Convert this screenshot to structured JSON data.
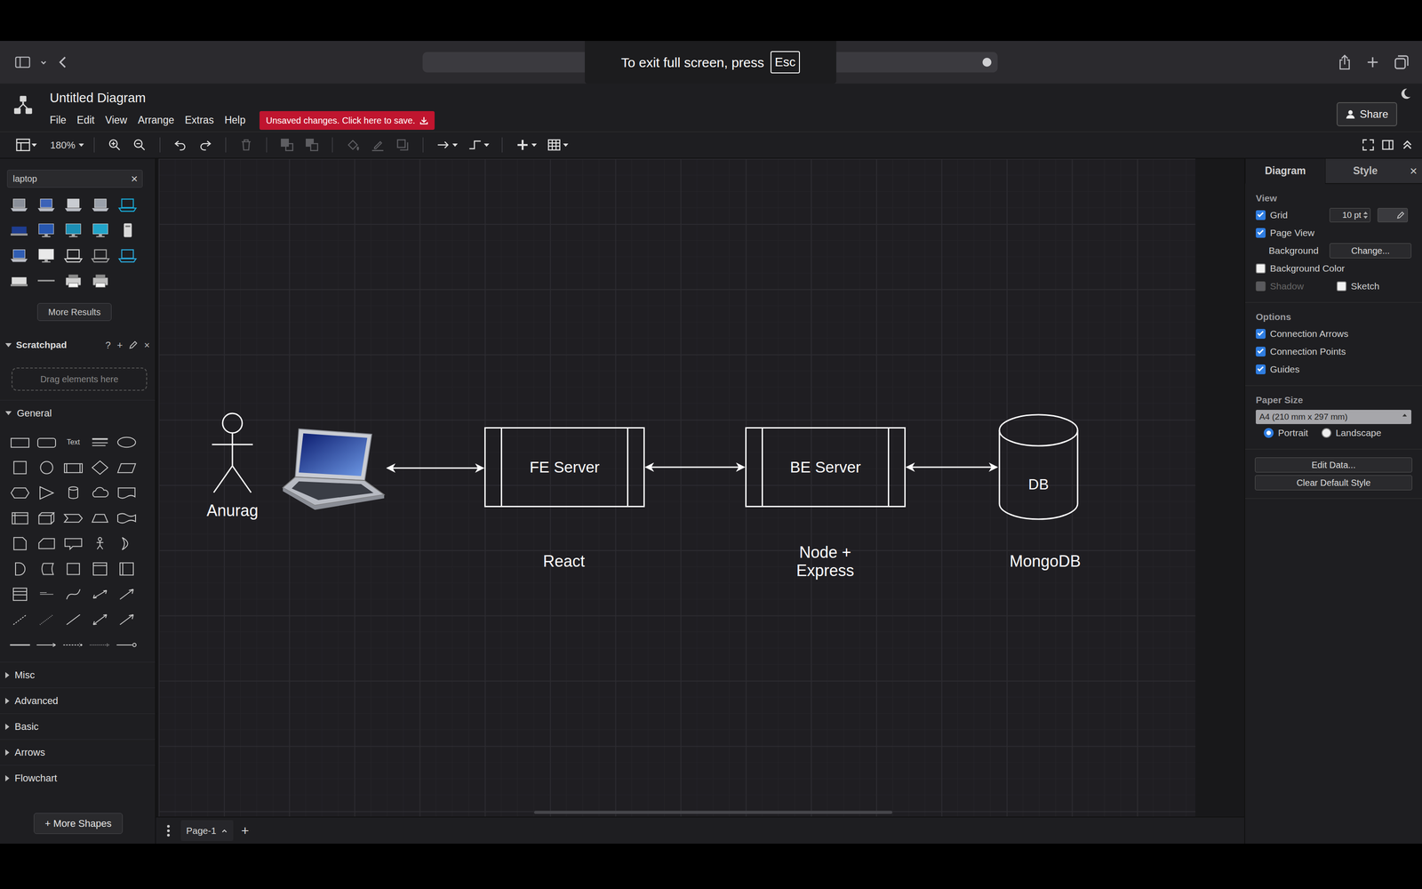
{
  "browser": {
    "hint": "To exit full screen, press",
    "key": "Esc"
  },
  "app": {
    "title": "Untitled Diagram",
    "menus": [
      "File",
      "Edit",
      "View",
      "Arrange",
      "Extras",
      "Help"
    ],
    "unsaved": "Unsaved changes. Click here to save.",
    "share": "Share"
  },
  "toolbar": {
    "zoom": "180%",
    "groups": [
      [
        {
          "kind": "zoom-in",
          "disabled": false
        },
        {
          "kind": "zoom-out",
          "disabled": false
        }
      ],
      [
        {
          "kind": "undo",
          "disabled": false
        },
        {
          "kind": "redo",
          "disabled": false
        }
      ],
      [
        {
          "kind": "delete",
          "disabled": true
        }
      ],
      [
        {
          "kind": "to-front",
          "disabled": true
        },
        {
          "kind": "to-back",
          "disabled": true
        }
      ],
      [
        {
          "kind": "fill",
          "disabled": true
        },
        {
          "kind": "line-color",
          "disabled": true
        },
        {
          "kind": "shadow",
          "disabled": true
        }
      ],
      [
        {
          "kind": "connection",
          "disabled": false
        },
        {
          "kind": "waypoints",
          "disabled": false
        }
      ],
      [
        {
          "kind": "insert",
          "disabled": false
        },
        {
          "kind": "table",
          "disabled": false
        }
      ]
    ]
  },
  "sidebar": {
    "search": {
      "value": "laptop",
      "clear": "×"
    },
    "more_results": "More Results",
    "scratchpad": {
      "title": "Scratchpad",
      "expanded": true,
      "help": "?",
      "add": "+",
      "close": "×",
      "hint": "Drag elements here"
    },
    "sections": [
      {
        "label": "General",
        "expanded": true
      },
      {
        "label": "Misc",
        "expanded": false
      },
      {
        "label": "Advanced",
        "expanded": false
      },
      {
        "label": "Basic",
        "expanded": false
      },
      {
        "label": "Arrows",
        "expanded": false
      },
      {
        "label": "Flowchart",
        "expanded": false
      }
    ],
    "shape_text": "Text",
    "more_shapes": "+ More Shapes"
  },
  "diagram": {
    "nodes": [
      {
        "kind": "actor",
        "label": "Anurag"
      },
      {
        "kind": "laptop"
      },
      {
        "kind": "process",
        "label": "FE Server"
      },
      {
        "kind": "process",
        "label": "BE Server"
      },
      {
        "kind": "cylinder",
        "label": "DB"
      },
      {
        "kind": "text",
        "label": "React"
      },
      {
        "kind": "text",
        "label": "Node +\nExpress"
      },
      {
        "kind": "text",
        "label": "MongoDB"
      }
    ],
    "edges": [
      {
        "from": 1,
        "to": 2,
        "arrows": "both"
      },
      {
        "from": 2,
        "to": 3,
        "arrows": "both"
      },
      {
        "from": 3,
        "to": 4,
        "arrows": "both"
      }
    ]
  },
  "format": {
    "tabs": [
      {
        "label": "Diagram",
        "selected": true
      },
      {
        "label": "Style",
        "selected": false
      }
    ],
    "close": "×",
    "view": {
      "title": "View",
      "grid": {
        "label": "Grid",
        "checked": true,
        "size": "10 pt"
      },
      "page_view": {
        "label": "Page View",
        "checked": true
      },
      "background": {
        "label": "Background",
        "button": "Change..."
      },
      "background_color": {
        "label": "Background Color",
        "checked": false
      },
      "shadow": {
        "label": "Shadow",
        "checked": false,
        "disabled": true
      },
      "sketch": {
        "label": "Sketch",
        "checked": false
      }
    },
    "options": {
      "title": "Options",
      "items": [
        {
          "label": "Connection Arrows",
          "checked": true
        },
        {
          "label": "Connection Points",
          "checked": true
        },
        {
          "label": "Guides",
          "checked": true
        }
      ]
    },
    "paper": {
      "title": "Paper Size",
      "value": "A4 (210 mm x 297 mm)",
      "orientations": [
        {
          "label": "Portrait",
          "selected": true
        },
        {
          "label": "Landscape",
          "selected": false
        }
      ]
    },
    "buttons": [
      "Edit Data...",
      "Clear Default Style"
    ]
  },
  "pages": {
    "tabs": [
      {
        "label": "Page-1",
        "selected": true
      }
    ],
    "add": "+"
  }
}
